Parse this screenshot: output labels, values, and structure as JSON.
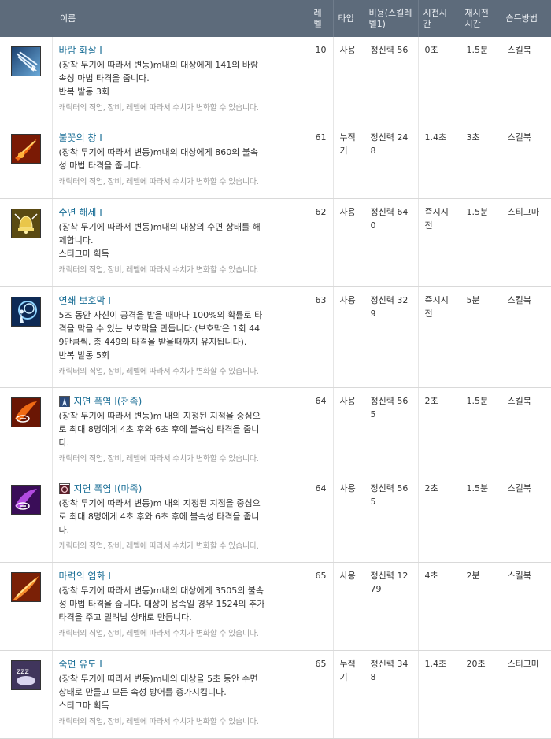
{
  "header": {
    "name": "이름",
    "level": "레벨",
    "type": "타입",
    "cost": "비용(스킬레벨1)",
    "cast_time": "시전시간",
    "cooldown": "재시전시간",
    "source": "습득방법"
  },
  "skills": [
    {
      "icon": "wind-arrow-icon",
      "name": "바람 화살 I",
      "desc": [
        "(장착 무기에 따라서 변동)m내의 대상에게 141의 바람",
        "속성 마법 타격을 줍니다.",
        "반복 발동 3회"
      ],
      "note": "캐릭터의 직업, 장비, 레벨에 따라서 수치가 변화할 수 있습니다.",
      "level": "10",
      "type": "사용",
      "cost": "정신력 56",
      "cast_time": "0초",
      "cooldown": "1.5분",
      "source": "스킬북"
    },
    {
      "icon": "flame-spear-icon",
      "name": "불꽃의 창 I",
      "desc": [
        "(장착 무기에 따라서 변동)m내의 대상에게 860의 불속",
        "성 마법 타격을 줍니다."
      ],
      "note": "캐릭터의 직업, 장비, 레벨에 따라서 수치가 변화할 수 있습니다.",
      "level": "61",
      "type": "누적기",
      "cost": "정신력 248",
      "cast_time": "1.4초",
      "cooldown": "3초",
      "source": "스킬북"
    },
    {
      "icon": "bell-icon",
      "name": "수면 해제 I",
      "desc": [
        "(장착 무기에 따라서 변동)m내의 대상의 수면 상태를 해",
        "제합니다.",
        "스티그마 획득"
      ],
      "note": "캐릭터의 직업, 장비, 레벨에 따라서 수치가 변화할 수 있습니다.",
      "level": "62",
      "type": "사용",
      "cost": "정신력 640",
      "cast_time": "즉시시전",
      "cooldown": "1.5분",
      "source": "스티그마"
    },
    {
      "icon": "chain-shield-icon",
      "name": "연쇄 보호막 I",
      "desc": [
        "5초 동안 자신이 공격을 받을 때마다 100%의 확률로 타",
        "격을 막을 수 있는 보호막을 만듭니다.(보호막은 1회 44",
        "9만큼씩, 총 449의 타격을 받을때까지 유지됩니다).",
        "반복 발동 5회"
      ],
      "note": "캐릭터의 직업, 장비, 레벨에 따라서 수치가 변화할 수 있습니다.",
      "level": "63",
      "type": "사용",
      "cost": "정신력 329",
      "cast_time": "즉시시전",
      "cooldown": "5분",
      "source": "스킬북"
    },
    {
      "icon": "delayed-blast-icon",
      "name": "지연 폭염 I(천족)",
      "faction": "elyos-icon",
      "desc": [
        "(장착 무기에 따라서 변동)m 내의 지정된 지점을 중심으",
        "로 최대 8명에게 4초 후와 6초 후에 불속성 타격을 줍니",
        "다."
      ],
      "note": "캐릭터의 직업, 장비, 레벨에 따라서 수치가 변화할 수 있습니다.",
      "level": "64",
      "type": "사용",
      "cost": "정신력 565",
      "cast_time": "2초",
      "cooldown": "1.5분",
      "source": "스킬북"
    },
    {
      "icon": "delayed-blast-dark-icon",
      "name": "지연 폭염 I(마족)",
      "faction": "asmodian-icon",
      "desc": [
        "(장착 무기에 따라서 변동)m 내의 지정된 지점을 중심으",
        "로 최대 8명에게 4초 후와 6초 후에 불속성 타격을 줍니",
        "다."
      ],
      "note": "캐릭터의 직업, 장비, 레벨에 따라서 수치가 변화할 수 있습니다.",
      "level": "64",
      "type": "사용",
      "cost": "정신력 565",
      "cast_time": "2초",
      "cooldown": "1.5분",
      "source": "스킬북"
    },
    {
      "icon": "inferno-icon",
      "name": "마력의 염화 I",
      "desc": [
        "(장착 무기에 따라서 변동)m내의 대상에게 3505의 불속",
        "성 마법 타격을 줍니다. 대상이 용족일 경우 1524의 추가",
        "타격을 주고 밀려남 상태로 만듭니다."
      ],
      "note": "캐릭터의 직업, 장비, 레벨에 따라서 수치가 변화할 수 있습니다.",
      "level": "65",
      "type": "사용",
      "cost": "정신력 1279",
      "cast_time": "4초",
      "cooldown": "2분",
      "source": "스킬북"
    },
    {
      "icon": "sleep-icon",
      "name": "숙면 유도 I",
      "desc": [
        "(장착 무기에 따라서 변동)m내의 대상을 5초 동안 수면",
        "상태로 만들고 모든 속성 방어를 증가시킵니다.",
        "스티그마 획득"
      ],
      "note": "캐릭터의 직업, 장비, 레벨에 따라서 수치가 변화할 수 있습니다.",
      "level": "65",
      "type": "누적기",
      "cost": "정신력 348",
      "cast_time": "1.4초",
      "cooldown": "20초",
      "source": "스티그마"
    }
  ]
}
